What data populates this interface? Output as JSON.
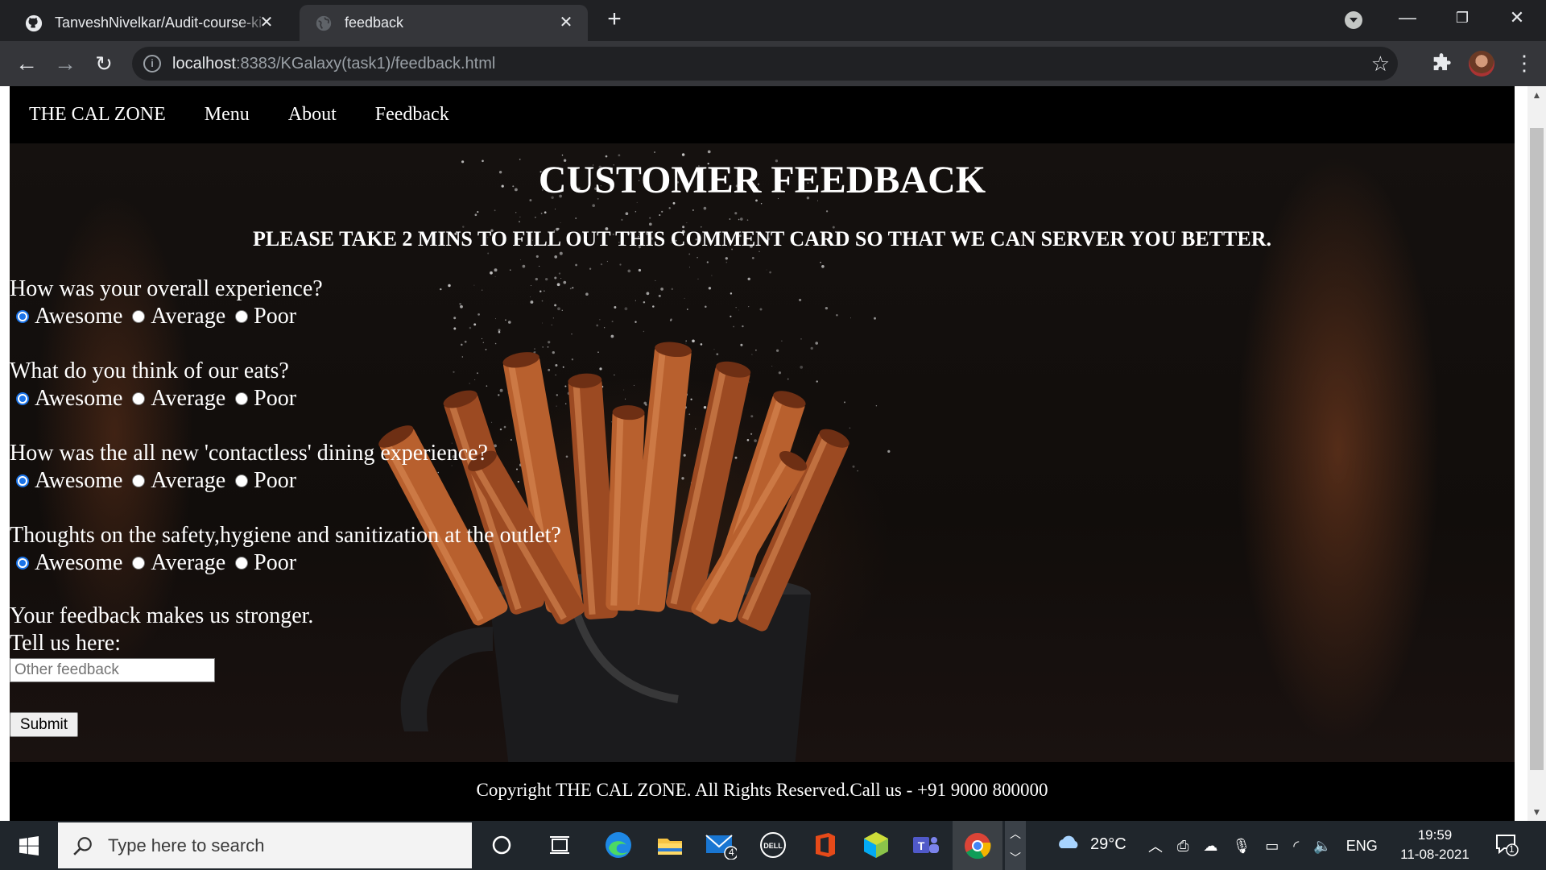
{
  "browser": {
    "tabs": [
      {
        "title": "TanveshNivelkar/Audit-course-ki",
        "favicon": "github-icon",
        "active": false
      },
      {
        "title": "feedback",
        "favicon": "globe-icon",
        "active": true
      }
    ],
    "address": {
      "host": "localhost",
      "path": ":8383/KGalaxy(task1)/feedback.html"
    }
  },
  "site": {
    "nav": {
      "brand": "THE CAL ZONE",
      "links": [
        "Menu",
        "About",
        "Feedback"
      ]
    },
    "heading": "CUSTOMER FEEDBACK",
    "subheading": "PLEASE TAKE 2 MINS TO FILL OUT THIS COMMENT CARD SO THAT WE CAN SERVER YOU BETTER.",
    "questions": [
      {
        "text": "How was your overall experience?",
        "options": [
          "Awesome",
          "Average",
          "Poor"
        ],
        "selected": 0
      },
      {
        "text": "What do you think of our eats?",
        "options": [
          "Awesome",
          "Average",
          "Poor"
        ],
        "selected": 0
      },
      {
        "text": "How was the all new 'contactless' dining experience?",
        "options": [
          "Awesome",
          "Average",
          "Poor"
        ],
        "selected": 0
      },
      {
        "text": "Thoughts on the safety,hygiene and sanitization at the outlet?",
        "options": [
          "Awesome",
          "Average",
          "Poor"
        ],
        "selected": 0
      }
    ],
    "feedback": {
      "line1": "Your feedback makes us stronger.",
      "line2": "Tell us here:",
      "placeholder": "Other feedback",
      "value": ""
    },
    "submit_label": "Submit",
    "footer": "Copyright THE CAL ZONE. All Rights Reserved.Call us - +91 9000 800000"
  },
  "taskbar": {
    "search_placeholder": "Type here to search",
    "mail_badge": "4",
    "weather": "29°C",
    "language": "ENG",
    "time": "19:59",
    "date": "11-08-2021",
    "notification_count": "1"
  },
  "colors": {
    "accent": "#1a73e8",
    "page_bg": "#0d0d0d",
    "chrome_dark": "#202124"
  }
}
